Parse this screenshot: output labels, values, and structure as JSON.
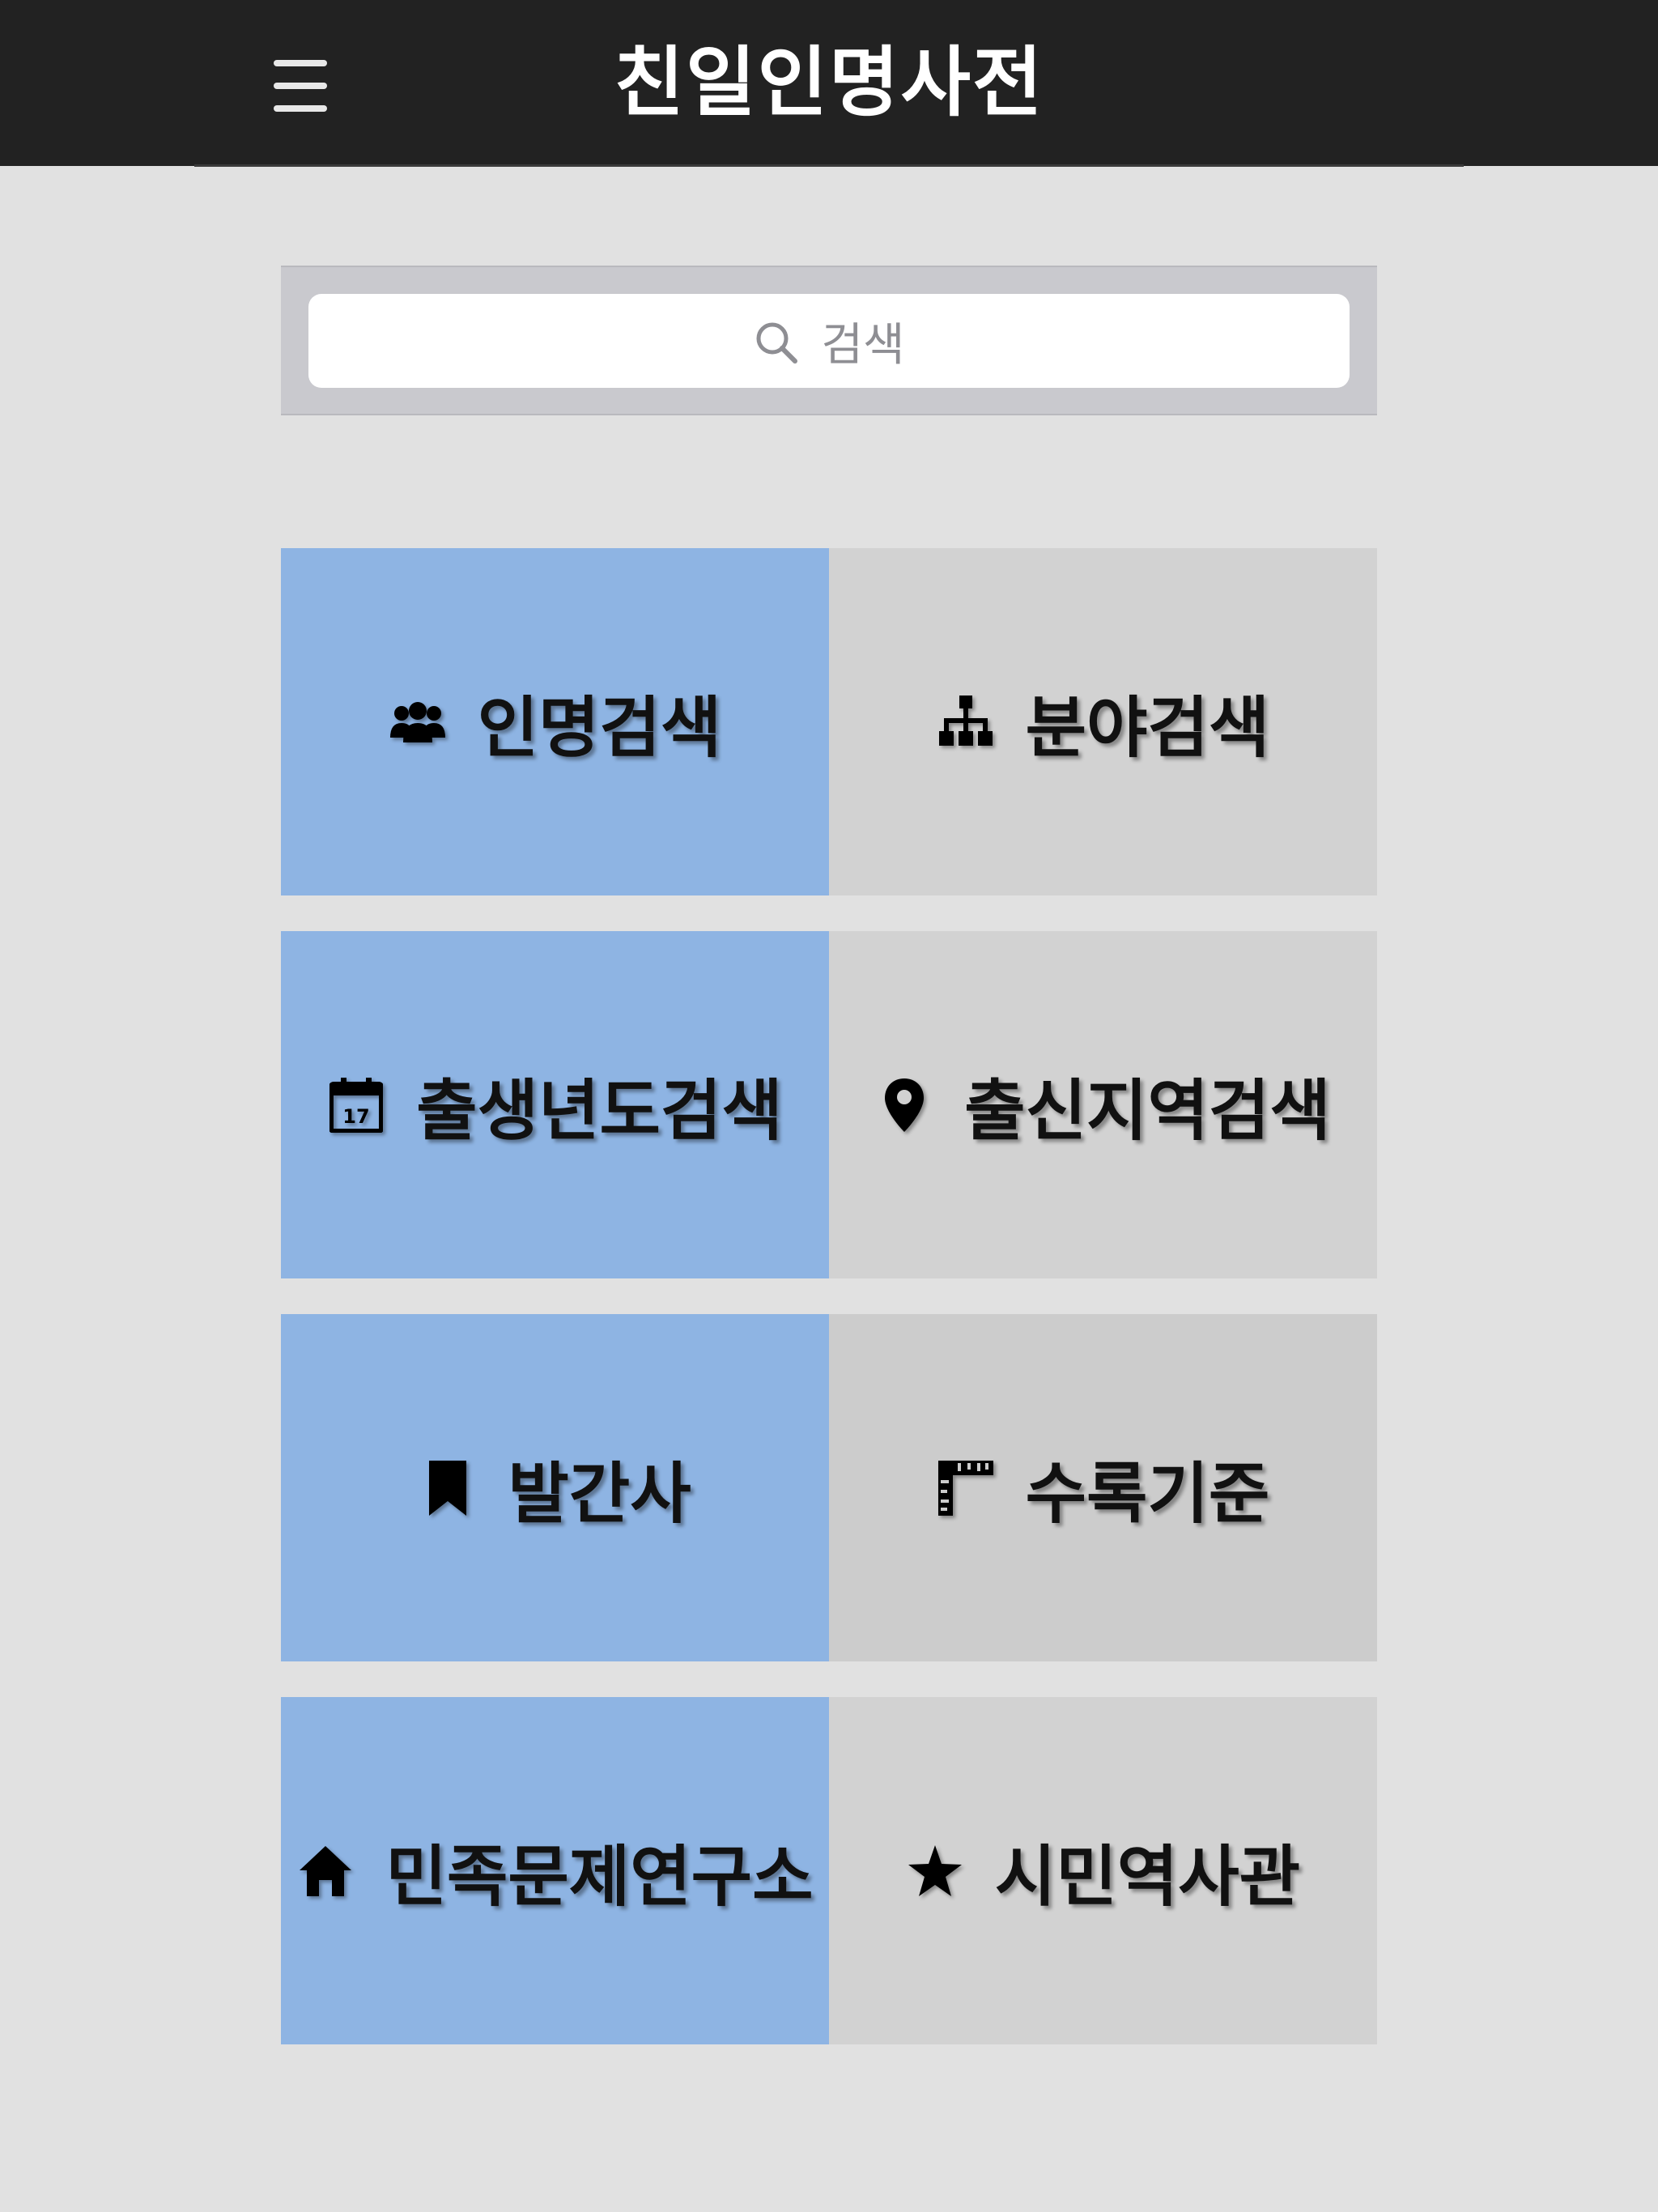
{
  "header": {
    "title": "친일인명사전",
    "menu_icon": "hamburger-menu-icon"
  },
  "search": {
    "placeholder": "검색",
    "icon": "search-icon"
  },
  "menu": [
    {
      "label": "인명검색",
      "icon": "people-icon",
      "color": "#8eb4e3"
    },
    {
      "label": "분야검색",
      "icon": "sitemap-icon",
      "color": "#d2d2d2"
    },
    {
      "label": "출생년도검색",
      "icon": "calendar-icon",
      "color": "#8eb4e3"
    },
    {
      "label": "출신지역검색",
      "icon": "map-pin-icon",
      "color": "#d2d2d2"
    },
    {
      "label": "발간사",
      "icon": "bookmark-icon",
      "color": "#8eb4e3"
    },
    {
      "label": "수록기준",
      "icon": "ruler-icon",
      "color": "#cccccc"
    },
    {
      "label": "민족문제연구소",
      "icon": "home-icon",
      "color": "#8eb4e3"
    },
    {
      "label": "시민역사관",
      "icon": "star-icon",
      "color": "#d2d2d2"
    }
  ]
}
